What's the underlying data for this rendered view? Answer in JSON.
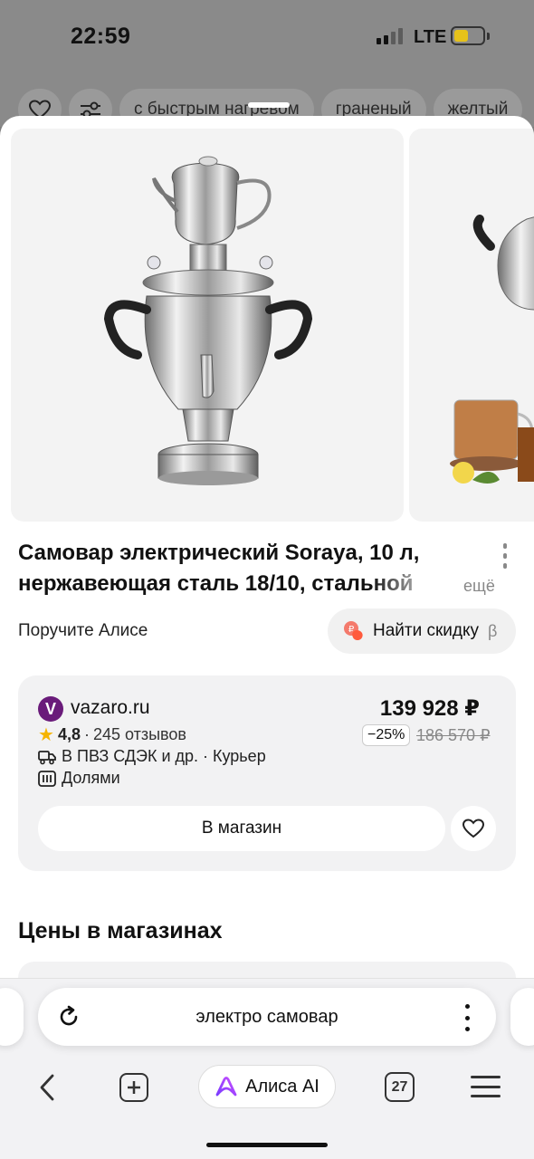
{
  "status_bar": {
    "time": "22:59",
    "network": "LTE",
    "battery_level": 0.5
  },
  "filters": {
    "chips": [
      "с быстрым нагревом",
      "граненый",
      "желтый"
    ],
    "icons": [
      "heart-icon",
      "sliders-icon"
    ]
  },
  "product": {
    "title": "Самовар электрический Soraya, 10 л, нержавеющая сталь 18/10, стальной",
    "more_label": "ещё",
    "ask_alice": "Поручите Алисе",
    "find_discount": "Найти скидку",
    "beta": "β"
  },
  "offer": {
    "shop_initial": "V",
    "shop_name": "vazaro.ru",
    "rating": "4,8",
    "separator": "·",
    "reviews": "245 отзывов",
    "delivery": "В ПВЗ СДЭК и др. · Курьер",
    "payment": "Долями",
    "price": "139 928 ₽",
    "discount": "−25%",
    "old_price": "186 570 ₽",
    "shop_button": "В магазин",
    "colors": {
      "shop_brand": "#6a1b7a",
      "star": "#f5b400"
    }
  },
  "section": {
    "title": "Цены в магазинах"
  },
  "browser": {
    "address": "электро самовар",
    "alice_label": "Алиса AI",
    "tabs_count": "27"
  }
}
